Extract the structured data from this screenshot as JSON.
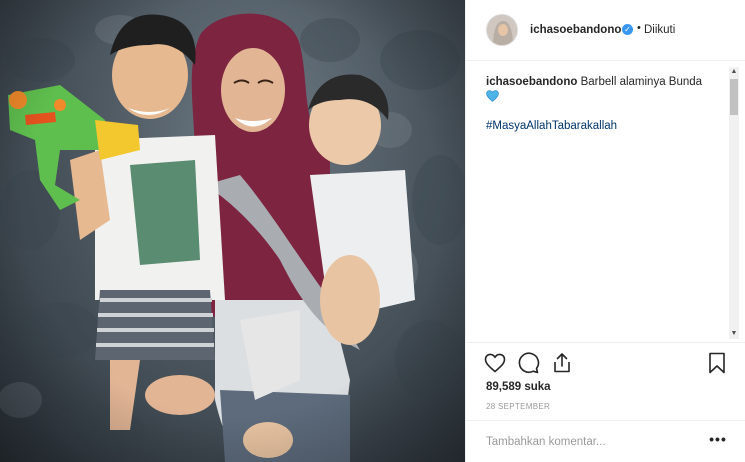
{
  "header": {
    "username": "ichasoebandono",
    "verified_mark": "✓",
    "separator": "•",
    "follow_state": "Diikuti"
  },
  "caption": {
    "username": "ichasoebandono",
    "text": "Barbell alaminya Bunda",
    "emoji": "blue-heart",
    "hashtag": "#MasyaAllahTabarakallah"
  },
  "actions": {
    "like_icon": "heart-icon",
    "comment_icon": "comment-icon",
    "share_icon": "share-icon",
    "save_icon": "bookmark-icon"
  },
  "stats": {
    "likes": "89,589 suka",
    "date": "28 SEPTEMBER"
  },
  "comment_box": {
    "placeholder": "Tambahkan komentar...",
    "more_label": "•••"
  },
  "scrollbar": {
    "up": "▲",
    "down": "▼"
  },
  "colors": {
    "verified": "#3897f0",
    "hashtag": "#003569",
    "heart_emoji": "#4fb3e8",
    "hijab": "#7d2440"
  }
}
